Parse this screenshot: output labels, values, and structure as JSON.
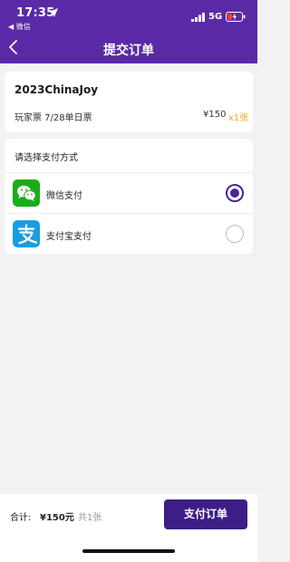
{
  "status_bar": {
    "time": "17:35",
    "back_app": "◀ 微信",
    "network": "5G"
  },
  "nav": {
    "title": "提交订单"
  },
  "order": {
    "event_name": "2023ChinaJoy",
    "ticket_name": "玩家票 7/28单日票",
    "price": "¥150",
    "quantity": "x1张"
  },
  "payment": {
    "header": "请选择支付方式",
    "options": [
      {
        "label": "微信支付",
        "icon": "wechat-pay-icon",
        "selected": true,
        "color": "#1aad19"
      },
      {
        "label": "支付宝支付",
        "icon": "alipay-icon",
        "selected": false,
        "color": "#1a9de0"
      }
    ]
  },
  "bottom": {
    "total_label": "合计:",
    "total_price": "¥150元",
    "total_count": "共1张",
    "submit_label": "支付订单"
  },
  "colors": {
    "header_bg": "#5a2aa6",
    "accent": "#3c1e86",
    "quantity": "#f5a623"
  }
}
